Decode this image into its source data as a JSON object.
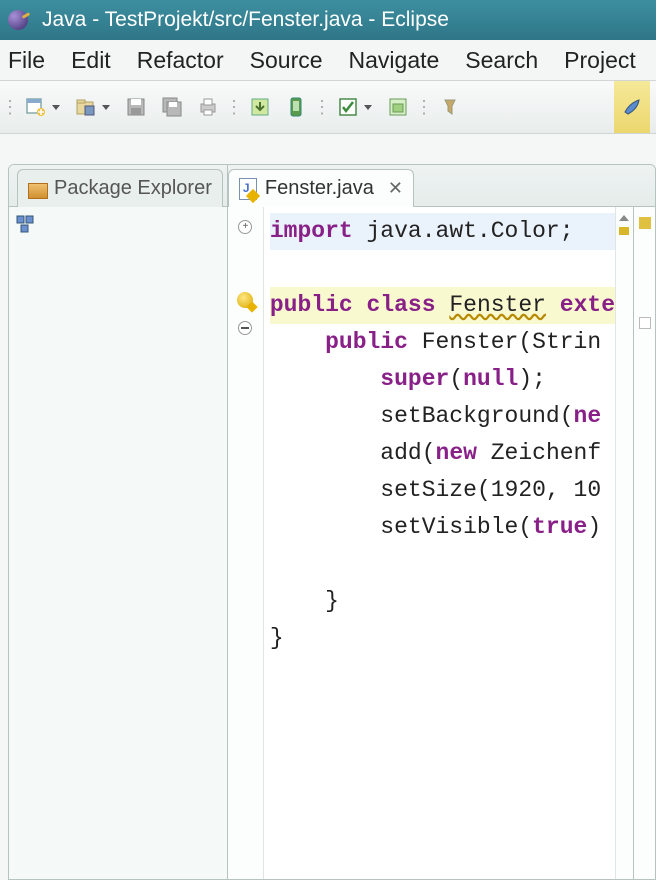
{
  "titlebar": {
    "title": "Java - TestProjekt/src/Fenster.java - Eclipse"
  },
  "menu": {
    "file": "File",
    "edit": "Edit",
    "refactor": "Refactor",
    "source": "Source",
    "navigate": "Navigate",
    "search": "Search",
    "project": "Project"
  },
  "views": {
    "package_explorer": {
      "title": "Package Explorer"
    },
    "editor_tab": {
      "title": "Fenster.java"
    }
  },
  "code": {
    "l1_kw": "import",
    "l1_rest": " java.awt.Color;",
    "l3_kw1": "public",
    "l3_kw2": "class",
    "l3_name": "Fenster",
    "l3_kw3": "exte",
    "l4_kw": "public",
    "l4_rest": " Fenster(Strin",
    "l5_kw1": "super",
    "l5_paren": "(",
    "l5_kw2": "null",
    "l5_end": ");",
    "l6_a": "setBackground(",
    "l6_kw": "ne",
    "l7_a": "add(",
    "l7_kw": "new",
    "l7_b": " Zeichenf",
    "l8": "setSize(1920, 10",
    "l9_a": "setVisible(",
    "l9_kw": "true",
    "l9_b": ")",
    "l11": "}",
    "l12": "}"
  }
}
